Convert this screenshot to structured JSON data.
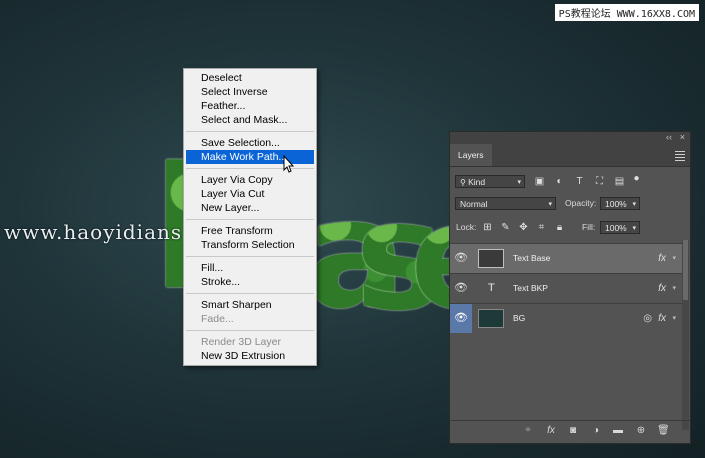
{
  "watermarks": {
    "top": "PS教程论坛 WWW.16XX8.COM",
    "middle": "www.haoyidians"
  },
  "canvas": {
    "letters": [
      "B",
      "a",
      "s",
      "e"
    ]
  },
  "context_menu": {
    "groups": [
      [
        {
          "label": "Deselect",
          "state": "normal"
        },
        {
          "label": "Select Inverse",
          "state": "normal"
        },
        {
          "label": "Feather...",
          "state": "normal"
        },
        {
          "label": "Select and Mask...",
          "state": "normal"
        }
      ],
      [
        {
          "label": "Save Selection...",
          "state": "normal"
        },
        {
          "label": "Make Work Path...",
          "state": "highlighted"
        }
      ],
      [
        {
          "label": "Layer Via Copy",
          "state": "normal"
        },
        {
          "label": "Layer Via Cut",
          "state": "normal"
        },
        {
          "label": "New Layer...",
          "state": "normal"
        }
      ],
      [
        {
          "label": "Free Transform",
          "state": "normal"
        },
        {
          "label": "Transform Selection",
          "state": "normal"
        }
      ],
      [
        {
          "label": "Fill...",
          "state": "normal"
        },
        {
          "label": "Stroke...",
          "state": "normal"
        }
      ],
      [
        {
          "label": "Smart Sharpen",
          "state": "normal"
        },
        {
          "label": "Fade...",
          "state": "disabled"
        }
      ],
      [
        {
          "label": "Render 3D Layer",
          "state": "disabled"
        },
        {
          "label": "New 3D Extrusion",
          "state": "normal"
        }
      ]
    ]
  },
  "layers_panel": {
    "collapse_glyph": "‹‹",
    "close_glyph": "×",
    "tab_label": "Layers",
    "filter": {
      "selected": "Kind"
    },
    "blend": {
      "selected": "Normal"
    },
    "opacity": {
      "label": "Opacity:",
      "value": "100%"
    },
    "lock": {
      "label": "Lock:"
    },
    "fill": {
      "label": "Fill:",
      "value": "100%"
    },
    "layers": [
      {
        "name": "Text Base",
        "kind": "text-raster",
        "fx": "fx",
        "selected": true
      },
      {
        "name": "Text BKP",
        "kind": "type",
        "fx": "fx",
        "selected": false
      },
      {
        "name": "BG",
        "kind": "smart-object",
        "fx": "fx",
        "selected": false
      }
    ]
  },
  "colors": {
    "menu_highlight": "#0a64d6",
    "panel_bg": "#535353",
    "selected_layer": "#6a6a6a",
    "eye_active": "#5b79a8"
  }
}
